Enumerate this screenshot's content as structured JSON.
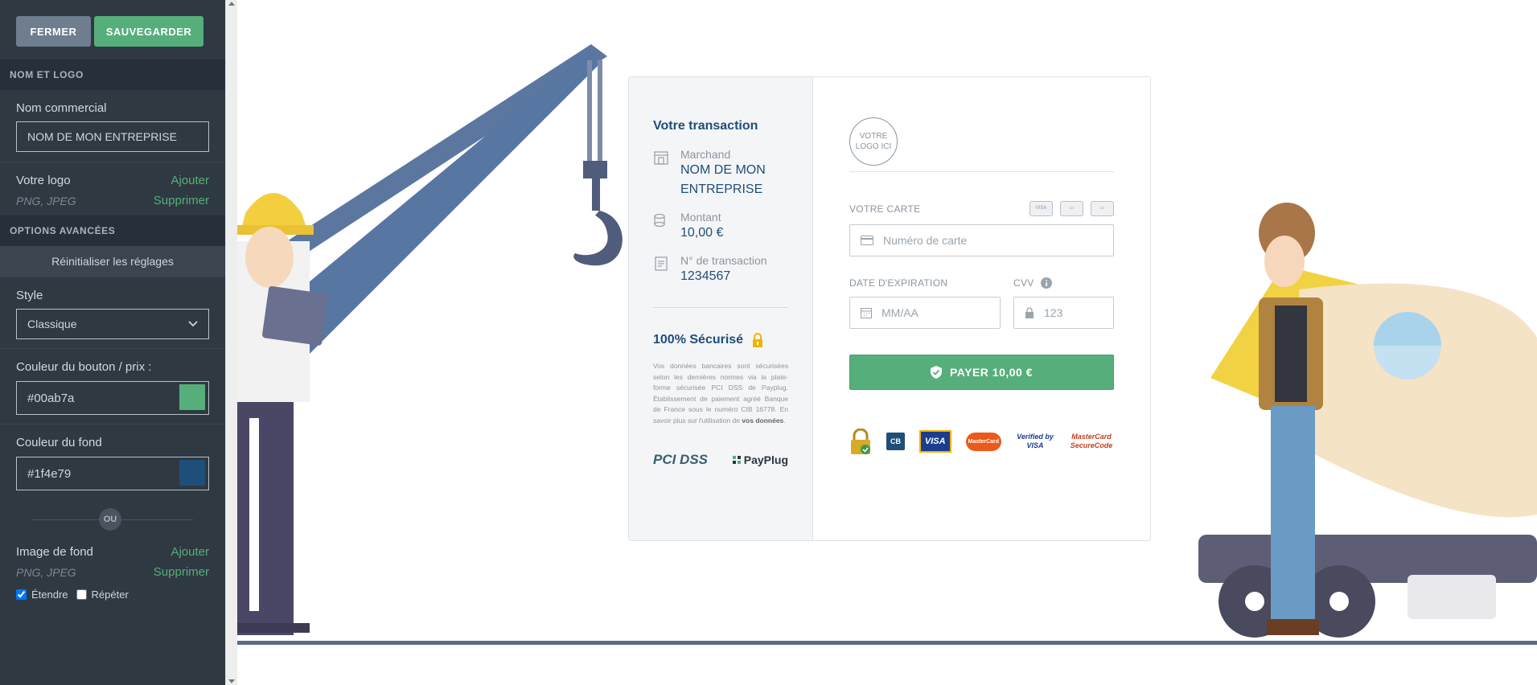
{
  "sidebar": {
    "close_label": "FERMER",
    "save_label": "SAUVEGARDER",
    "section_name_logo": "NOM ET LOGO",
    "commercial_name_label": "Nom commercial",
    "commercial_name_value": "NOM DE MON ENTREPRISE",
    "logo_label": "Votre logo",
    "logo_add": "Ajouter",
    "logo_formats": "PNG, JPEG",
    "logo_remove": "Supprimer",
    "section_advanced": "OPTIONS AVANCÉES",
    "reset_label": "Réinitialiser les réglages",
    "style_label": "Style",
    "style_value": "Classique",
    "button_color_label": "Couleur du bouton / prix :",
    "button_color_value": "#00ab7a",
    "button_color_swatch": "#56ae7b",
    "bg_color_label": "Couleur du fond",
    "bg_color_value": "#1f4e79",
    "bg_color_swatch": "#1f4e79",
    "ou_label": "OU",
    "bg_image_label": "Image de fond",
    "bg_image_add": "Ajouter",
    "bg_image_formats": "PNG, JPEG",
    "bg_image_remove": "Supprimer",
    "stretch_label": "Étendre",
    "stretch_checked": true,
    "repeat_label": "Répéter",
    "repeat_checked": false
  },
  "payment": {
    "title": "Votre transaction",
    "merchant_label": "Marchand",
    "merchant_value": "NOM DE MON ENTREPRISE",
    "amount_label": "Montant",
    "amount_value": "10,00 €",
    "tx_label": "N° de transaction",
    "tx_value": "1234567",
    "secure_title": "100% Sécurisé",
    "secure_text": "Vos données bancaires sont sécurisées selon les dernières normes via la plate-forme sécurisée PCI DSS de Payplug. Établissement de paiement agréé Banque de France sous le numéro CIB 16778. En savoir plus sur l'utilisation de",
    "secure_link": "vos données",
    "pci_label": "PCI DSS",
    "payplug_label": "PayPlug",
    "logo_placeholder": "VOTRE LOGO ICI",
    "card_label": "VOTRE CARTE",
    "card_placeholder": "Numéro de carte",
    "expiry_label": "DATE D'EXPIRATION",
    "expiry_placeholder": "MM/AA",
    "cvv_label": "CVV",
    "cvv_placeholder": "123",
    "pay_label": "PAYER 10,00 €",
    "brand_cb": "CB",
    "brand_visa": "VISA",
    "brand_mastercard": "MasterCard",
    "brand_verified": "Verified by VISA",
    "brand_securecode": "MasterCard SecureCode"
  }
}
